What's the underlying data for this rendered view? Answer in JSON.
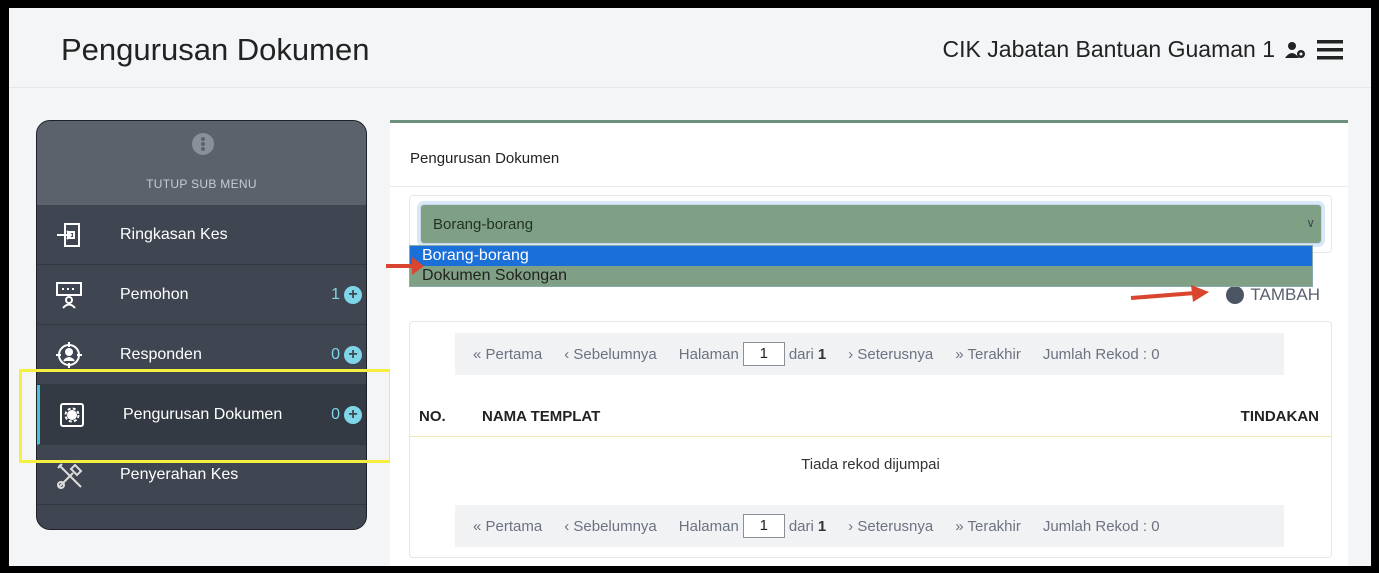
{
  "header": {
    "title": "Pengurusan Dokumen",
    "user": "CIK Jabatan Bantuan Guaman 1"
  },
  "sidebar": {
    "toggle_label": "TUTUP SUB MENU",
    "items": [
      {
        "label": "Ringkasan Kes",
        "icon": "sign-in-icon"
      },
      {
        "label": "Pemohon",
        "count": "1",
        "icon": "presenter-icon"
      },
      {
        "label": "Responden",
        "count": "0",
        "icon": "target-user-icon"
      },
      {
        "label": "Pengurusan Dokumen",
        "count": "0",
        "icon": "gear-icon"
      },
      {
        "label": "Penyerahan Kes",
        "icon": "tools-icon"
      }
    ]
  },
  "panel": {
    "title": "Pengurusan Dokumen",
    "select": {
      "value": "Borang-borang",
      "options": [
        "Borang-borang",
        "Dokumen Sokongan"
      ]
    },
    "add_label": "TAMBAH"
  },
  "pager": {
    "first": "Pertama",
    "prev": "Sebelumnya",
    "page_label": "Halaman",
    "page": "1",
    "of_label": "dari",
    "total_pages": "1",
    "next": "Seterusnya",
    "last": "Terakhir",
    "records": "Jumlah Rekod : 0"
  },
  "table": {
    "col_no": "NO.",
    "col_name": "NAMA TEMPLAT",
    "col_action": "TINDAKAN",
    "empty": "Tiada rekod dijumpai"
  },
  "colors": {
    "accent": "#7fd6e9",
    "select_bg": "#7fa084",
    "highlight": "#f5ef3f",
    "arrow": "#d9452f",
    "option_selected": "#1a6fd8"
  }
}
